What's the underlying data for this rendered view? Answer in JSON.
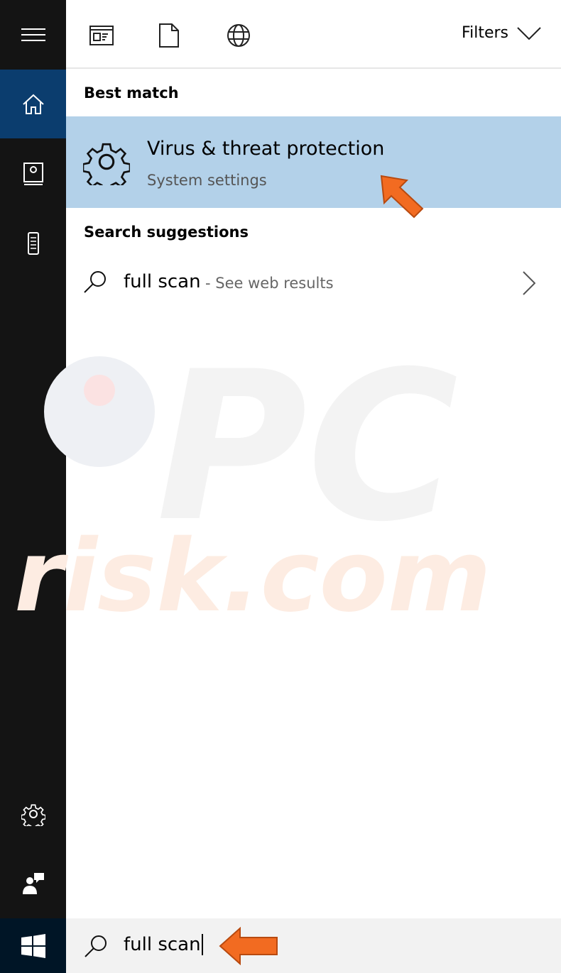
{
  "topbar": {
    "filters_label": "Filters"
  },
  "results": {
    "best_match_heading": "Best match",
    "best_match": {
      "title": "Virus & threat protection",
      "subtitle": "System settings"
    },
    "suggestions_heading": "Search suggestions",
    "suggestion": {
      "query": "full scan",
      "suffix": " - See web results"
    }
  },
  "search": {
    "value": "full scan"
  },
  "watermark": "PC risk.com",
  "colors": {
    "sidebar": "#141414",
    "active": "#0b3d6e",
    "highlight": "#b3d1e9",
    "arrow": "#f26b21"
  }
}
